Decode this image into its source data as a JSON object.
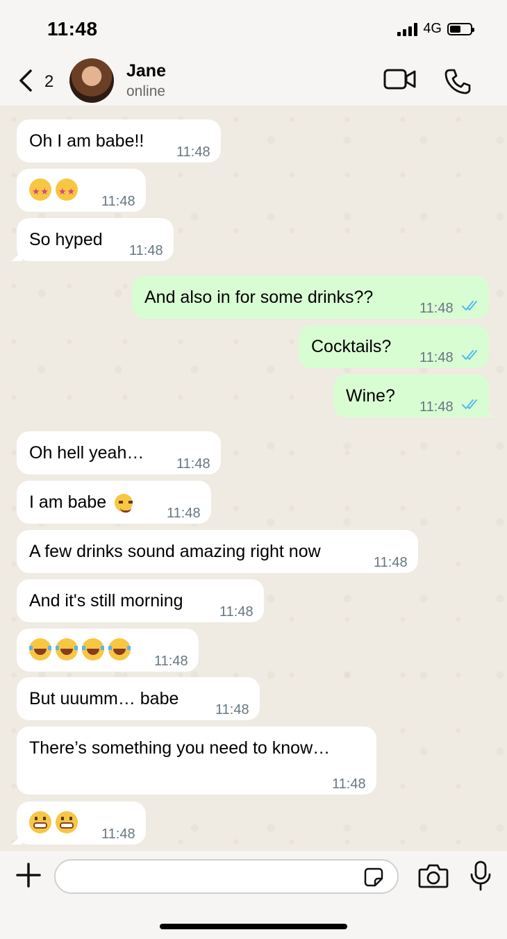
{
  "status_bar": {
    "time": "11:48",
    "network": "4G",
    "battery_level": 0.55
  },
  "header": {
    "back_count": "2",
    "contact_name": "Jane",
    "contact_status": "online"
  },
  "messages": [
    {
      "dir": "in",
      "text": "Oh I am babe!!",
      "time": "11:48"
    },
    {
      "dir": "in",
      "emoji": [
        "star-struck-emoji",
        "star-struck-emoji"
      ],
      "time": "11:48"
    },
    {
      "dir": "in",
      "text": "So hyped",
      "time": "11:48"
    },
    {
      "dir": "out",
      "text": "And also in for some drinks??",
      "time": "11:48",
      "read": true
    },
    {
      "dir": "out",
      "text": "Cocktails?",
      "time": "11:48",
      "read": true
    },
    {
      "dir": "out",
      "text": "Wine?",
      "time": "11:48",
      "read": true
    },
    {
      "dir": "in",
      "text": "Oh hell yeah…",
      "time": "11:48"
    },
    {
      "dir": "in",
      "text": "I am babe",
      "emoji_after": "smirk-emoji",
      "time": "11:48"
    },
    {
      "dir": "in",
      "text": "A few drinks sound amazing right now",
      "time": "11:48"
    },
    {
      "dir": "in",
      "text": "And it's still morning",
      "time": "11:48"
    },
    {
      "dir": "in",
      "emoji": [
        "laughing-tears-emoji",
        "laughing-tears-emoji",
        "laughing-tears-emoji",
        "laughing-tears-emoji"
      ],
      "time": "11:48"
    },
    {
      "dir": "in",
      "text": "But uuumm… babe",
      "time": "11:48"
    },
    {
      "dir": "in",
      "text": "There’s something you need to know…",
      "time": "11:48"
    },
    {
      "dir": "in",
      "emoji": [
        "grimacing-emoji",
        "grimacing-emoji"
      ],
      "time": "11:48"
    }
  ],
  "composer": {
    "placeholder": ""
  },
  "colors": {
    "incoming": "#ffffff",
    "outgoing": "#d9fdd3",
    "read_tick": "#53bdeb",
    "timestamp": "#667781"
  },
  "icons": [
    "back-chevron-icon",
    "video-call-icon",
    "phone-icon",
    "plus-icon",
    "sticker-icon",
    "camera-icon",
    "mic-icon"
  ]
}
